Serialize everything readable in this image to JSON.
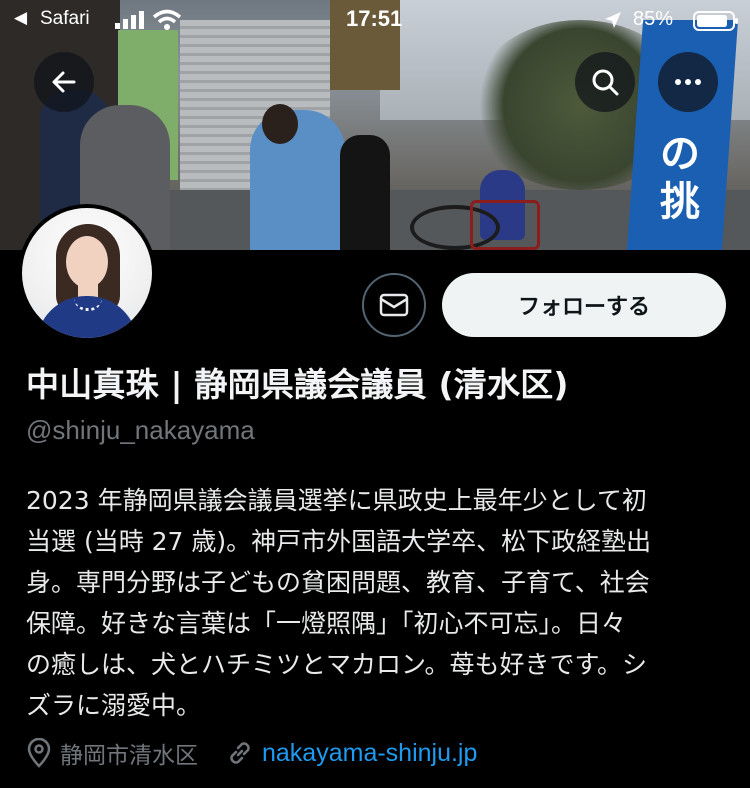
{
  "status_bar": {
    "back_app": "Safari",
    "time": "17:51",
    "battery": "85%"
  },
  "banner": {
    "flag_text": "の挑"
  },
  "actions": {
    "follow_label": "フォローする"
  },
  "profile": {
    "name": "中山真珠 | 静岡県議会議員 (清水区)",
    "handle": "@shinju_nakayama",
    "bio_lines": [
      "2023 年静岡県議会議員選挙に県政史上最年少として初",
      "当選 (当時 27 歳)。神戸市外国語大学卒、松下政経塾出",
      "身。専門分野は子どもの貧困問題、教育、子育て、社会",
      "保障。好きな言葉は「一燈照隅」「初心不可忘」。日々",
      "の癒しは、犬とハチミツとマカロン。苺も好きです。シ",
      "ズラに溺愛中。"
    ],
    "location": "静岡市清水区",
    "website": "nakayama-shinju.jp"
  },
  "colors": {
    "background": "#000000",
    "text": "#e7e9ea",
    "muted": "#71767b",
    "link": "#1d9bf0",
    "follow_bg": "#eff3f4"
  },
  "icons": [
    "back-arrow-icon",
    "search-icon",
    "more-icon",
    "mail-icon",
    "location-pin-icon",
    "link-icon",
    "signal-icon",
    "wifi-icon",
    "location-arrow-icon",
    "battery-icon"
  ]
}
